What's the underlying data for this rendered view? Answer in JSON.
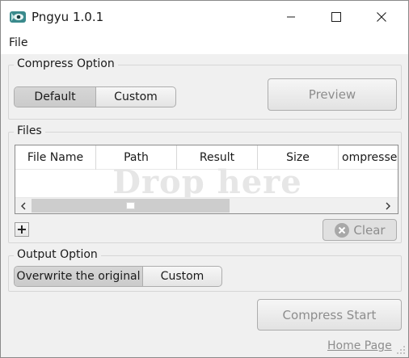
{
  "window": {
    "title": "Pngyu 1.0.1",
    "icon": "pngyu-app-icon"
  },
  "menu": {
    "items": [
      {
        "label": "File"
      }
    ]
  },
  "compress_option": {
    "title": "Compress Option",
    "modes": [
      {
        "label": "Default",
        "selected": true
      },
      {
        "label": "Custom",
        "selected": false
      }
    ],
    "preview_label": "Preview",
    "preview_enabled": false
  },
  "files": {
    "title": "Files",
    "columns": [
      "File Name",
      "Path",
      "Result",
      "Size",
      "ompressec"
    ],
    "drop_hint": "Drop here",
    "rows": [],
    "add_label": "+",
    "clear_label": "Clear",
    "clear_enabled": false,
    "scroll_left_icon": "chevron-left-icon",
    "scroll_right_icon": "chevron-right-icon"
  },
  "output_option": {
    "title": "Output Option",
    "modes": [
      {
        "label": "Overwrite the original",
        "selected": true
      },
      {
        "label": "Custom",
        "selected": false
      }
    ]
  },
  "actions": {
    "compress_start_label": "Compress Start",
    "compress_start_enabled": false,
    "home_page_label": "Home Page"
  },
  "colors": {
    "window_bg": "#f0f0f0",
    "disabled_text": "#8d8d8d",
    "clear_icon_bg": "#a8a8a8"
  }
}
